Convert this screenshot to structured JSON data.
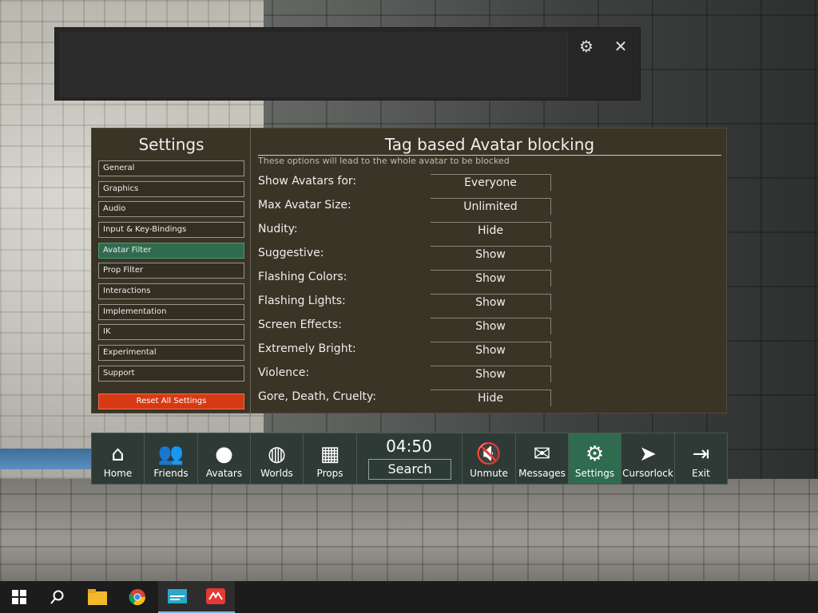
{
  "settings": {
    "title": "Settings",
    "items": [
      {
        "label": "General",
        "active": false
      },
      {
        "label": "Graphics",
        "active": false
      },
      {
        "label": "Audio",
        "active": false
      },
      {
        "label": "Input & Key-Bindings",
        "active": false
      },
      {
        "label": "Avatar Filter",
        "active": true
      },
      {
        "label": "Prop Filter",
        "active": false
      },
      {
        "label": "Interactions",
        "active": false
      },
      {
        "label": "Implementation",
        "active": false
      },
      {
        "label": "IK",
        "active": false
      },
      {
        "label": "Experimental",
        "active": false
      },
      {
        "label": "Support",
        "active": false
      }
    ],
    "reset_label": "Reset All Settings"
  },
  "main": {
    "title": "Tag based Avatar blocking",
    "subtitle": "These options will lead to the whole avatar to be blocked",
    "rows": [
      {
        "label": "Show Avatars for:",
        "value": "Everyone"
      },
      {
        "label": "Max Avatar Size:",
        "value": "Unlimited"
      },
      {
        "label": "Nudity:",
        "value": "Hide"
      },
      {
        "label": "Suggestive:",
        "value": "Show"
      },
      {
        "label": "Flashing Colors:",
        "value": "Show"
      },
      {
        "label": "Flashing Lights:",
        "value": "Show"
      },
      {
        "label": "Screen Effects:",
        "value": "Show"
      },
      {
        "label": "Extremely Bright:",
        "value": "Show"
      },
      {
        "label": "Violence:",
        "value": "Show"
      },
      {
        "label": "Gore, Death, Cruelty:",
        "value": "Hide"
      }
    ]
  },
  "nav": {
    "items": [
      {
        "label": "Home",
        "icon": "home-icon"
      },
      {
        "label": "Friends",
        "icon": "friends-icon"
      },
      {
        "label": "Avatars",
        "icon": "avatar-icon"
      },
      {
        "label": "Worlds",
        "icon": "globe-icon"
      },
      {
        "label": "Props",
        "icon": "cube-icon"
      }
    ],
    "clock": "04:50",
    "search_label": "Search",
    "right_items": [
      {
        "label": "Unmute",
        "icon": "muted-speaker-icon"
      },
      {
        "label": "Messages",
        "icon": "envelope-icon"
      },
      {
        "label": "Settings",
        "icon": "gear-icon",
        "active": true
      },
      {
        "label": "Cursorlock",
        "icon": "cursor-icon"
      },
      {
        "label": "Exit",
        "icon": "exit-icon"
      }
    ]
  },
  "colors": {
    "accent_active": "#2f6b4f",
    "reset_red": "#d63a14",
    "panel_bg": "#3a3426"
  }
}
